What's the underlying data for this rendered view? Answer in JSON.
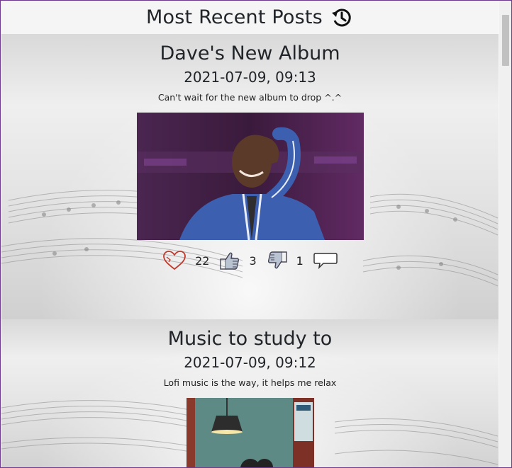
{
  "header": {
    "title": "Most Recent Posts",
    "icon": "history-icon"
  },
  "posts": [
    {
      "title": "Dave's New Album",
      "datetime": "2021-07-09, 09:13",
      "body": "Can't wait for the new album to drop ^.^",
      "image": "man-in-blue-track-jacket-photo",
      "likes": "22",
      "thumbs_up": "3",
      "thumbs_down": "1"
    },
    {
      "title": "Music to study to",
      "datetime": "2021-07-09, 09:12",
      "body": "Lofi music is the way, it helps me relax",
      "image": "lofi-room-illustration"
    }
  ],
  "colors": {
    "heart": "#c0392b",
    "scroll_thumb": "#c1c1c1",
    "window_border": "#6d3a8e"
  }
}
